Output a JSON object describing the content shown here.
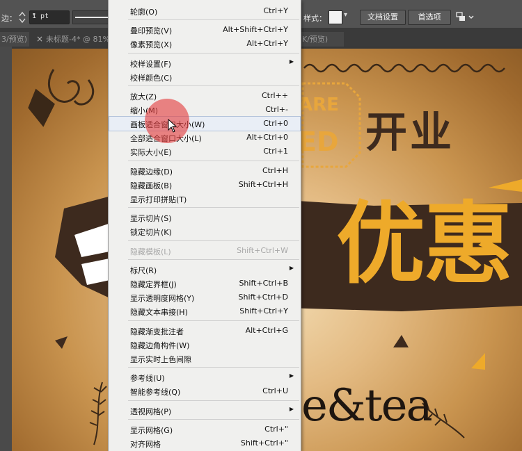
{
  "control_bar": {
    "stroke_label": "边：",
    "stroke_value": "1 pt",
    "style_label": "样式：",
    "doc_settings": "文档设置",
    "preferences": "首选项",
    "colors": {
      "bar": "#535353",
      "field": "#2b2b2b"
    }
  },
  "tabs": [
    {
      "label": "3/预览)"
    },
    {
      "label": "未标题-4* @ 81%"
    },
    {
      "label": "K/预览)"
    }
  ],
  "artwork": {
    "badge_line1": "ARE",
    "badge_line2": "ED",
    "opening": "开业",
    "promo_text": "优惠",
    "brand_text": "e&tea",
    "colors": {
      "gold": "#eeaa2a",
      "dark_brown": "#3d2a1e",
      "background": "#c9944f"
    }
  },
  "menu": {
    "items": [
      {
        "label": "轮廓(O)",
        "shortcut": "Ctrl+Y"
      },
      {
        "label": "叠印预览(V)",
        "shortcut": "Alt+Shift+Ctrl+Y"
      },
      {
        "label": "像素预览(X)",
        "shortcut": "Alt+Ctrl+Y"
      },
      {
        "label": "校样设置(F)",
        "shortcut": "",
        "submenu": true
      },
      {
        "label": "校样颜色(C)",
        "shortcut": ""
      },
      {
        "label": "放大(Z)",
        "shortcut": "Ctrl++"
      },
      {
        "label": "缩小(M)",
        "shortcut": "Ctrl+-"
      },
      {
        "label": "画板适合窗口大小(W)",
        "shortcut": "Ctrl+0",
        "highlighted": true
      },
      {
        "label": "全部适合窗口大小(L)",
        "shortcut": "Alt+Ctrl+0"
      },
      {
        "label": "实际大小(E)",
        "shortcut": "Ctrl+1"
      },
      {
        "label": "隐藏边缘(D)",
        "shortcut": "Ctrl+H"
      },
      {
        "label": "隐藏画板(B)",
        "shortcut": "Shift+Ctrl+H"
      },
      {
        "label": "显示打印拼贴(T)",
        "shortcut": ""
      },
      {
        "label": "显示切片(S)",
        "shortcut": ""
      },
      {
        "label": "锁定切片(K)",
        "shortcut": ""
      },
      {
        "label": "隐藏模板(L)",
        "shortcut": "Shift+Ctrl+W",
        "disabled": true
      },
      {
        "label": "标尺(R)",
        "shortcut": "",
        "submenu": true
      },
      {
        "label": "隐藏定界框(J)",
        "shortcut": "Shift+Ctrl+B"
      },
      {
        "label": "显示透明度网格(Y)",
        "shortcut": "Shift+Ctrl+D"
      },
      {
        "label": "隐藏文本串接(H)",
        "shortcut": "Shift+Ctrl+Y"
      },
      {
        "label": "隐藏渐变批注者",
        "shortcut": "Alt+Ctrl+G"
      },
      {
        "label": "隐藏边角构件(W)",
        "shortcut": ""
      },
      {
        "label": "显示实时上色间隙",
        "shortcut": ""
      },
      {
        "label": "参考线(U)",
        "shortcut": "",
        "submenu": true
      },
      {
        "label": "智能参考线(Q)",
        "shortcut": "Ctrl+U"
      },
      {
        "label": "透视网格(P)",
        "shortcut": "",
        "submenu": true
      },
      {
        "label": "显示网格(G)",
        "shortcut": "Ctrl+\""
      },
      {
        "label": "对齐网格",
        "shortcut": "Shift+Ctrl+\""
      }
    ],
    "submenu_glyph": "▶"
  }
}
